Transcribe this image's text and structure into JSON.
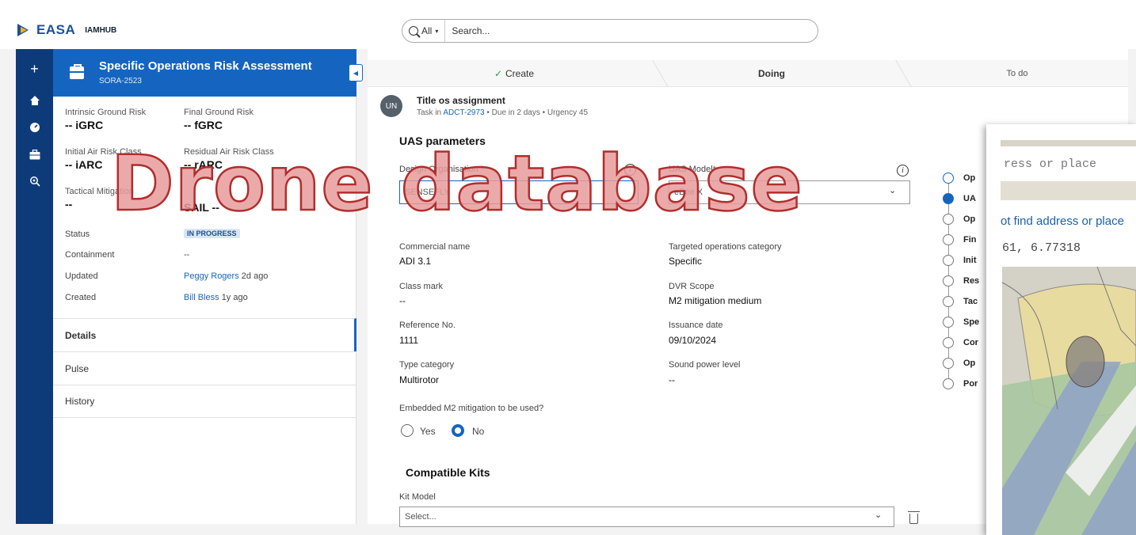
{
  "app": {
    "logo_text": "EASA",
    "logo_sub": "IAMHUB"
  },
  "search": {
    "scope": "All",
    "placeholder": "Search..."
  },
  "nav": {
    "icons": [
      "plus-icon",
      "home-icon",
      "dashboard-icon",
      "briefcase-icon",
      "search-settings-icon"
    ]
  },
  "record": {
    "title": "Specific Operations Risk Assessment",
    "id": "SORA-2523",
    "fields": {
      "igr_label": "Intrinsic Ground Risk",
      "igr_value": "-- iGRC",
      "fgr_label": "Final Ground Risk",
      "fgr_value": "-- fGRC",
      "iarc_label": "Initial Air Risk Class",
      "iarc_value": "-- iARC",
      "rarc_label": "Residual Air Risk Class",
      "rarc_value": "-- rARC",
      "tm_label": "Tactical Mitigation",
      "tm_value": "--",
      "sail_value": "SAIL --"
    },
    "status_label": "Status",
    "status_value": "IN PROGRESS",
    "containment_label": "Containment",
    "containment_value": "--",
    "updated_label": "Updated",
    "updated_user": "Peggy Rogers",
    "updated_time": "2d ago",
    "created_label": "Created",
    "created_user": "Bill Bless",
    "created_time": "1y ago",
    "tabs": [
      "Details",
      "Pulse",
      "History"
    ]
  },
  "stepper": {
    "steps": [
      "Create",
      "Doing",
      "To do"
    ]
  },
  "assignment": {
    "avatar": "UN",
    "title": "Title os assignment",
    "sub_prefix": "Task in",
    "sub_link": "ADCT-2973",
    "sub_suffix": "• Due in 2 days • Urgency 45"
  },
  "uas": {
    "section_title": "UAS parameters",
    "design_org_label": "Design Organisation",
    "design_org_value": "SENSEFLY",
    "uas_model_label": "UAS Model",
    "uas_model_value": "eBee X",
    "commercial_name_label": "Commercial name",
    "commercial_name_value": "ADI 3.1",
    "targeted_ops_label": "Targeted operations category",
    "targeted_ops_value": "Specific",
    "class_mark_label": "Class mark",
    "class_mark_value": "--",
    "dvr_scope_label": "DVR Scope",
    "dvr_scope_value": "M2 mitigation medium",
    "ref_no_label": "Reference No.",
    "ref_no_value": "1111",
    "issuance_label": "Issuance date",
    "issuance_value": "09/10/2024",
    "type_cat_label": "Type category",
    "type_cat_value": "Multirotor",
    "sound_label": "Sound power level",
    "sound_value": "--",
    "embedded_label": "Embedded M2 mitigation to be used?",
    "yes_label": "Yes",
    "no_label": "No"
  },
  "kits": {
    "section_title": "Compatible Kits",
    "kit_model_label": "Kit Model",
    "kit_model_placeholder": "Select..."
  },
  "vsteps": [
    "Op",
    "UA",
    "Op",
    "Fin",
    "Init",
    "Res",
    "Tac",
    "Spe",
    "Cor",
    "Op",
    "Por"
  ],
  "map": {
    "input_placeholder": "ress or place",
    "message": "ot find address or place",
    "coords": "61, 6.77318"
  },
  "watermark": "Drone database"
}
